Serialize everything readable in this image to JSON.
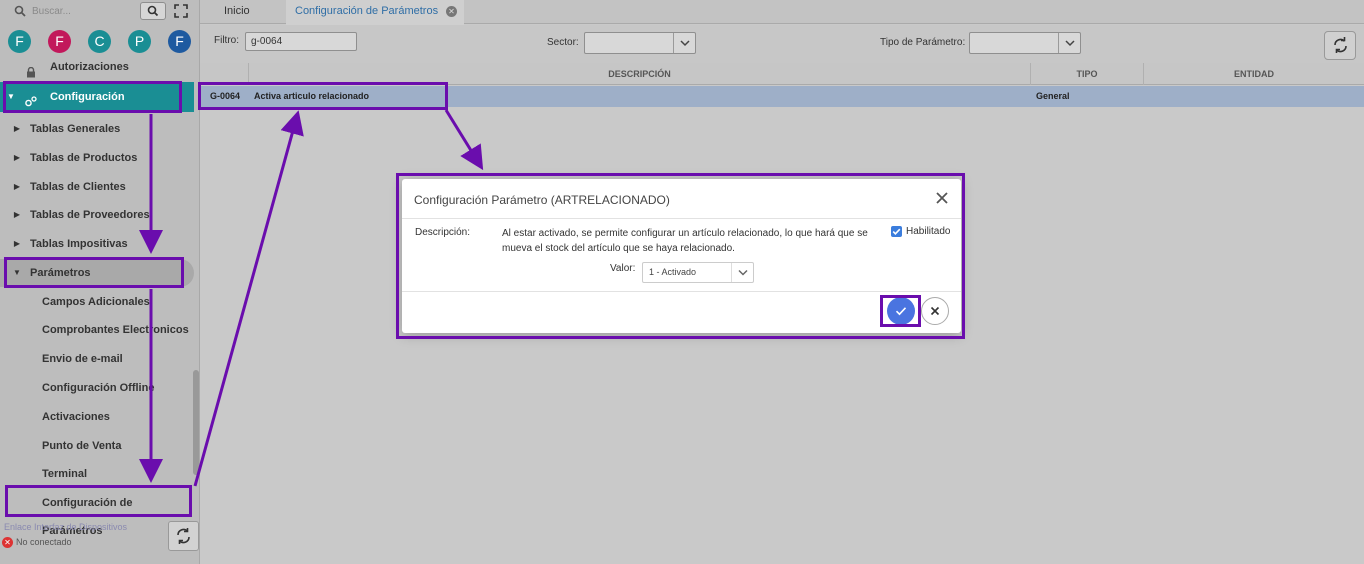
{
  "sidebar": {
    "search_placeholder": "Buscar...",
    "avatars": [
      {
        "letter": "F",
        "color": "#1a8e94"
      },
      {
        "letter": "F",
        "color": "#c2185b"
      },
      {
        "letter": "C",
        "color": "#1a8e94"
      },
      {
        "letter": "P",
        "color": "#1a8e94"
      },
      {
        "letter": "F",
        "color": "#1e5aa0"
      }
    ],
    "items": [
      {
        "label": "Autorizaciones"
      },
      {
        "label": "Configuración"
      },
      {
        "label": "Tablas Generales"
      },
      {
        "label": "Tablas de Productos"
      },
      {
        "label": "Tablas de Clientes"
      },
      {
        "label": "Tablas de Proveedores"
      },
      {
        "label": "Tablas Impositivas"
      },
      {
        "label": "Parámetros"
      },
      {
        "label": "Campos Adicionales"
      },
      {
        "label": "Comprobantes Electronicos"
      },
      {
        "label": "Envio de e-mail"
      },
      {
        "label": "Configuración Offline"
      },
      {
        "label": "Activaciones"
      },
      {
        "label": "Punto de Venta"
      },
      {
        "label": "Terminal"
      },
      {
        "label": "Configuración de Parámetros"
      }
    ],
    "footer": {
      "link": "Enlace Interfaz de Dispositivos",
      "status": "No conectado"
    }
  },
  "tabs": {
    "inicio": "Inicio",
    "config": "Configuración de Parámetros"
  },
  "filters": {
    "filtro_label": "Filtro:",
    "filtro_value": "g-0064",
    "sector_label": "Sector:",
    "tipo_label": "Tipo de Parámetro:"
  },
  "grid": {
    "headers": {
      "descripcion": "DESCRIPCIÓN",
      "tipo": "TIPO",
      "entidad": "ENTIDAD"
    },
    "row": {
      "code": "G-0064",
      "descripcion": "Activa articulo relacionado",
      "tipo": "General",
      "entidad": ""
    }
  },
  "modal": {
    "title": "Configuración Parámetro (ARTRELACIONADO)",
    "desc_label": "Descripción:",
    "desc_text": "Al estar activado, se permite configurar un artículo relacionado, lo que hará que se mueva el stock del artículo que se haya relacionado.",
    "habilitado_label": "Habilitado",
    "habilitado_checked": true,
    "valor_label": "Valor:",
    "valor_value": "1 - Activado"
  },
  "colors": {
    "annotation": "#6a0dad",
    "teal": "#1a8e94",
    "ok_button": "#4a74e0"
  }
}
